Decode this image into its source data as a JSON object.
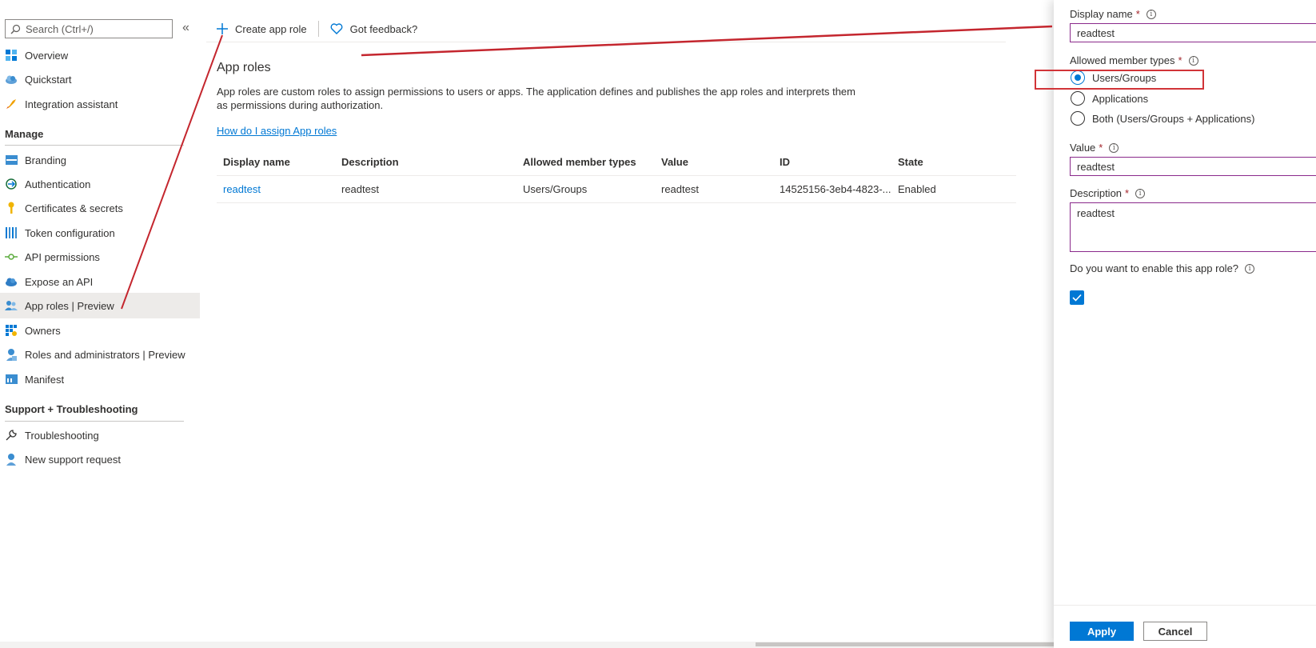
{
  "sidebar": {
    "search_placeholder": "Search (Ctrl+/)",
    "collapse_glyph": "«",
    "items": [
      {
        "label": "Overview",
        "icon": "overview-grid-icon"
      },
      {
        "label": "Quickstart",
        "icon": "cloud-quickstart-icon"
      },
      {
        "label": "Integration assistant",
        "icon": "rocket-icon"
      }
    ],
    "manage_title": "Manage",
    "manage_items": [
      {
        "label": "Branding",
        "icon": "branding-icon"
      },
      {
        "label": "Authentication",
        "icon": "authentication-icon"
      },
      {
        "label": "Certificates & secrets",
        "icon": "key-icon"
      },
      {
        "label": "Token configuration",
        "icon": "token-bars-icon"
      },
      {
        "label": "API permissions",
        "icon": "api-permissions-icon"
      },
      {
        "label": "Expose an API",
        "icon": "cloud-api-icon"
      },
      {
        "label": "App roles | Preview",
        "icon": "app-roles-people-icon"
      },
      {
        "label": "Owners",
        "icon": "owners-grid-icon"
      },
      {
        "label": "Roles and administrators | Preview",
        "icon": "roles-admin-icon"
      },
      {
        "label": "Manifest",
        "icon": "manifest-icon"
      }
    ],
    "support_title": "Support + Troubleshooting",
    "support_items": [
      {
        "label": "Troubleshooting",
        "icon": "wrench-icon"
      },
      {
        "label": "New support request",
        "icon": "support-person-icon"
      }
    ]
  },
  "toolbar": {
    "create_label": "Create app role",
    "feedback_label": "Got feedback?"
  },
  "main": {
    "title": "App roles",
    "intro": "App roles are custom roles to assign permissions to users or apps. The application defines and publishes the app roles and interprets them as permissions during authorization.",
    "help_link": "How do I assign App roles",
    "table": {
      "headers": [
        "Display name",
        "Description",
        "Allowed member types",
        "Value",
        "ID",
        "State"
      ],
      "rows": [
        [
          "readtest",
          "readtest",
          "Users/Groups",
          "readtest",
          "14525156-3eb4-4823-...",
          "Enabled"
        ]
      ]
    }
  },
  "panel": {
    "display_name_label": "Display name",
    "display_name_value": "readtest",
    "member_types_label": "Allowed member types",
    "member_types": [
      "Users/Groups",
      "Applications",
      "Both (Users/Groups + Applications)"
    ],
    "member_type_selected": "Users/Groups",
    "value_label": "Value",
    "value_value": "readtest",
    "description_label": "Description",
    "description_value": "readtest",
    "enable_label": "Do you want to enable this app role?",
    "enable_checked": true,
    "required_mark": "*",
    "info_glyph": "i",
    "apply_label": "Apply",
    "cancel_label": "Cancel"
  },
  "colors": {
    "accent": "#0078d4",
    "required": "#a4262c",
    "annotation": "#d13438",
    "input_border": "#8a2a8b"
  }
}
